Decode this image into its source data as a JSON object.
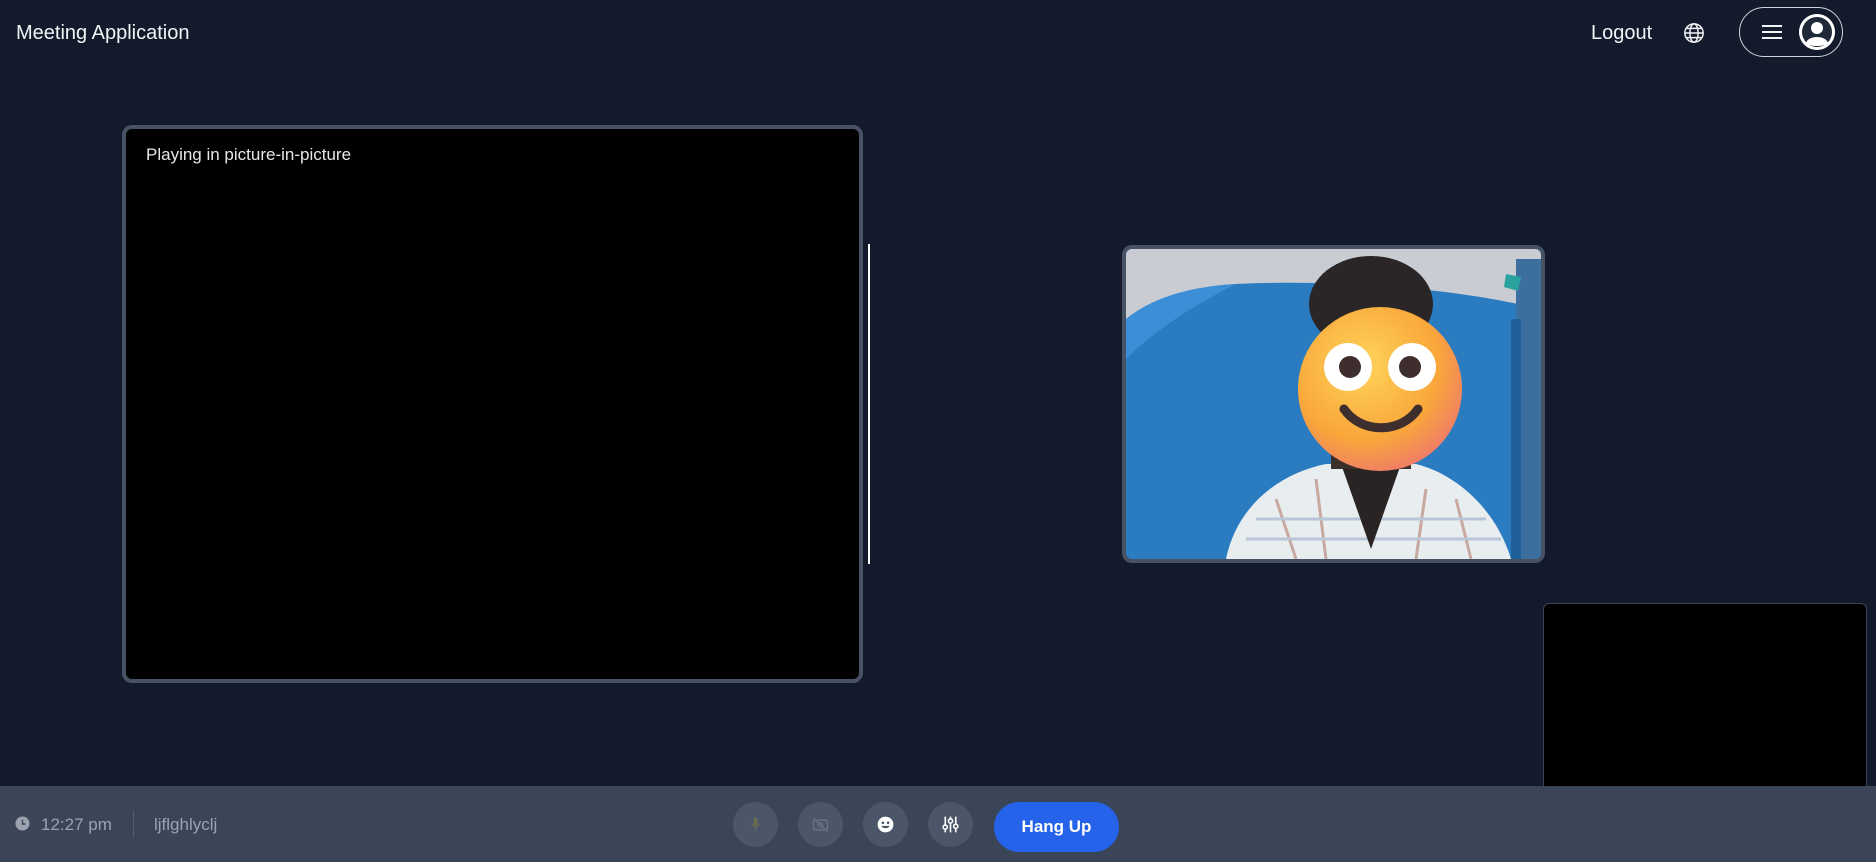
{
  "header": {
    "app_title": "Meeting Application",
    "logout_label": "Logout",
    "language_icon": "globe-icon",
    "menu_icon": "hamburger-menu-icon",
    "avatar_icon": "user-avatar-icon"
  },
  "main_video": {
    "status_text": "Playing in picture-in-picture"
  },
  "remote_video": {
    "content": "participant-webcam-feed",
    "overlay_icon": "smiley-face-emoji"
  },
  "self_view": {
    "content": "blank-video"
  },
  "footer": {
    "clock_icon": "clock-icon",
    "time": "12:27 pm",
    "meeting_code": "ljflghlyclj",
    "controls": [
      {
        "name": "microphone",
        "icon": "mic-icon"
      },
      {
        "name": "camera",
        "icon": "camera-off-icon"
      },
      {
        "name": "reactions",
        "icon": "emoji-icon"
      },
      {
        "name": "settings",
        "icon": "sliders-icon"
      }
    ],
    "hang_up_label": "Hang Up"
  },
  "colors": {
    "background": "#121a2b",
    "bottom_bar": "#3a4558",
    "tile_border": "#475264",
    "hang_up": "#2563eb"
  }
}
